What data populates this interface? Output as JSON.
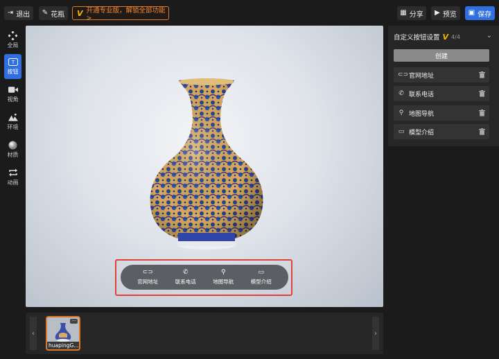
{
  "topbar": {
    "exit_label": "退出",
    "model_name": "花瓶",
    "promo_v": "V",
    "promo_text": "开通专业版，解锁全部功能 >",
    "share_label": "分享",
    "preview_label": "预览",
    "save_label": "保存"
  },
  "sidebar": {
    "items": [
      {
        "label": "全局",
        "icon": "global-icon"
      },
      {
        "label": "按钮",
        "icon": "button-icon"
      },
      {
        "label": "视角",
        "icon": "camera-icon"
      },
      {
        "label": "环境",
        "icon": "mountain-icon"
      },
      {
        "label": "材质",
        "icon": "sphere-icon"
      },
      {
        "label": "动画",
        "icon": "loop-icon"
      }
    ],
    "active_index": 1
  },
  "viewport": {
    "buttons": [
      {
        "label": "官网地址",
        "icon": "link-icon"
      },
      {
        "label": "联系电话",
        "icon": "phone-icon"
      },
      {
        "label": "地图导航",
        "icon": "location-icon"
      },
      {
        "label": "模型介绍",
        "icon": "image-icon"
      }
    ]
  },
  "strip": {
    "thumb_name": "huapingG...",
    "more": "···"
  },
  "right_panel": {
    "title": "自定义按钮设置",
    "v_mark": "V",
    "count": "4/4",
    "create_label": "创建",
    "rows": [
      {
        "label": "官网地址",
        "icon": "link-icon"
      },
      {
        "label": "联系电话",
        "icon": "phone-icon"
      },
      {
        "label": "地图导航",
        "icon": "location-icon"
      },
      {
        "label": "模型介绍",
        "icon": "image-icon"
      }
    ]
  },
  "colors": {
    "accent": "#2f6fe0",
    "promo": "#e07a2a",
    "highlight": "#e0403a",
    "vip": "#f7b500"
  }
}
